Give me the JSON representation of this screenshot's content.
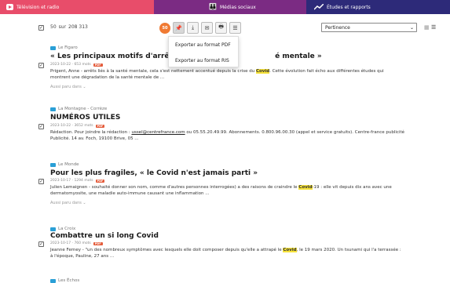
{
  "tabs": [
    {
      "label": "Télévision et radio",
      "icon": "play-icon",
      "color": "#e84d6a"
    },
    {
      "label": "Médias sociaux",
      "icon": "people-icon",
      "color": "#7b2b83"
    },
    {
      "label": "Études et rapports",
      "icon": "trend-icon",
      "color": "#2d2a79"
    }
  ],
  "toolbar": {
    "selected": "50",
    "sur": "sur",
    "total": "208 313",
    "badge": "50",
    "sort": "Pertinence"
  },
  "dropdown": {
    "pdf": "Exporter au format PDF",
    "ris": "Exporter au format RIS"
  },
  "articles": [
    {
      "source": "Le Figaro",
      "title": "« Les principaux motifs d'arrêt des Fra",
      "title_end": "é mentale »",
      "meta": "2023-10-22 · 653 mots",
      "body_pre": "Prigent, Anne - arrêts liés à la santé mentale, cela s'est nettement accentué depuis la crise du ",
      "body_hl": "Covid",
      "body_post": ". Cette évolution fait écho aux différentes études qui",
      "body_line2": "montrent une dégradation de la santé mentale de ...",
      "more": "Aussi paru dans ⌄"
    },
    {
      "source": "La Montagne - Corrèze",
      "title": "NUMÉROS UTILES",
      "meta": "2023-10-22 · 3652 mots",
      "body_pre": "Rédaction. Pour joindre la rédaction : ",
      "body_link": "ussel@centrefrance.com",
      "body_post": " ou 05.55.20.49.99. Abonnements. 0.800.96.00.30 (appel et service gratuits). Centre-france publicité",
      "body_line2": "Publicité. 14 av. Foch, 19100 Brive, 05 ..."
    },
    {
      "source": "Le Monde",
      "title": "Pour les plus fragiles, « le Covid n'est jamais parti »",
      "meta": "2023-10-17 · 1294 mots",
      "body_pre": "Julien Lemaignen - souhaité donner son nom, comme d'autres personnes interrogées) a des raisons de craindre le ",
      "body_hl": "Covid",
      "body_post": "-19 : elle vit depuis dix ans avec une",
      "body_line2": "dermatomyosite, une maladie auto-immune causant une inflammation ...",
      "more": "Aussi paru dans ⌄"
    },
    {
      "source": "La Croix",
      "title": "Combattre un si long Covid",
      "meta": "2023-10-17 · 760 mots",
      "body_pre": "Jeanne Ferney - \"un des nombreux symptômes avec lesquels elle doit composer depuis qu'elle a attrapé le ",
      "body_hl": "Covid",
      "body_post": ", le 19 mars 2020. Un tsunami qui l'a terrassée :",
      "body_line2": "à l'époque, Pauline, 27 ans ..."
    },
    {
      "source": "Les Échos"
    }
  ],
  "pdf_label": "PDF",
  "colors": {
    "accent": "#f07a33",
    "highlight": "#f6e23a",
    "source_icon": "#2a9fd6"
  }
}
